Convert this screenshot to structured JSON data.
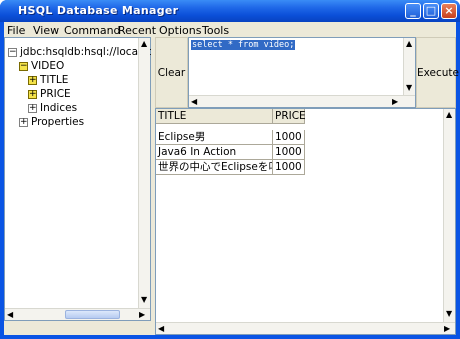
{
  "window": {
    "title": "HSQL Database Manager",
    "colors": {
      "titlebar": "#0b4fd8",
      "selection": "#316ac5",
      "tree_expander": "#f4e34a"
    }
  },
  "menu": [
    "File",
    "View",
    "Command",
    "Recent",
    "Options",
    "Tools"
  ],
  "tree": {
    "root": "jdbc:hsqldb:hsql://localhost",
    "table": "VIDEO",
    "columns": [
      "TITLE",
      "PRICE"
    ],
    "indices": "Indices",
    "properties": "Properties"
  },
  "buttons": {
    "clear": "Clear",
    "execute": "Execute"
  },
  "sql": {
    "text": "select * from video;"
  },
  "results": {
    "headers": [
      "TITLE",
      "PRICE"
    ],
    "rows": [
      [
        "Eclipse男",
        "1000"
      ],
      [
        "Java6 In Action",
        "1000"
      ],
      [
        "世界の中心でEclipseを叫ぶ",
        "1000"
      ]
    ]
  }
}
